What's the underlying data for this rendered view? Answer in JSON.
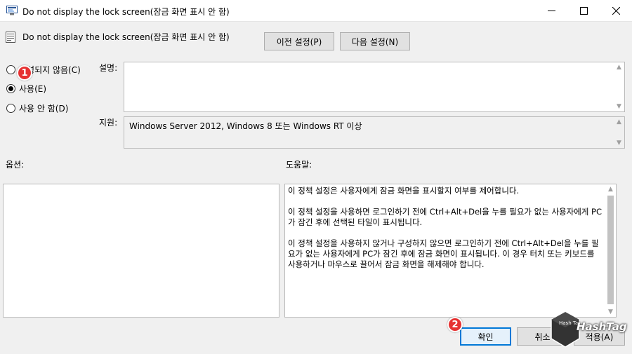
{
  "window": {
    "title": "Do not display the lock screen(잠금 화면 표시 안 함)"
  },
  "header": {
    "policy_title": "Do not display the lock screen(잠금 화면 표시 안 함)",
    "prev_button": "이전 설정(P)",
    "next_button": "다음 설정(N)"
  },
  "state_options": [
    {
      "label": "구성되지 않음(C)",
      "selected": false
    },
    {
      "label": "사용(E)",
      "selected": true
    },
    {
      "label": "사용 안 함(D)",
      "selected": false
    }
  ],
  "comment": {
    "label": "설명:",
    "value": ""
  },
  "supported": {
    "label": "지원:",
    "value": "Windows Server 2012, Windows 8 또는 Windows RT 이상"
  },
  "options": {
    "label": "옵션:"
  },
  "help": {
    "label": "도움말:",
    "paragraphs": [
      "이 정책 설정은 사용자에게 잠금 화면을 표시할지 여부를 제어합니다.",
      "이 정책 설정을 사용하면 로그인하기 전에 Ctrl+Alt+Del을 누를 필요가 없는 사용자에게 PC가 잠긴 후에 선택된 타일이 표시됩니다.",
      "이 정책 설정을 사용하지 않거나 구성하지 않으면 로그인하기 전에 Ctrl+Alt+Del을 누를 필요가 없는 사용자에게 PC가 잠긴 후에 잠금 화면이 표시됩니다. 이 경우 터치 또는 키보드를 사용하거나 마우스로 끌어서 잠금 화면을 해제해야 합니다."
    ]
  },
  "footer": {
    "ok_button": "확인",
    "cancel_button": "취소",
    "apply_button": "적용(A)"
  },
  "annotations": {
    "badge1": "1",
    "badge2": "2"
  },
  "watermark": {
    "text": "HashTag",
    "cube_text": "Hash Tag"
  },
  "colors": {
    "badge": "#e63232",
    "focus_border": "#0078d7"
  },
  "icons": {
    "app": "policy-editor-icon",
    "header": "policy-setting-icon"
  }
}
